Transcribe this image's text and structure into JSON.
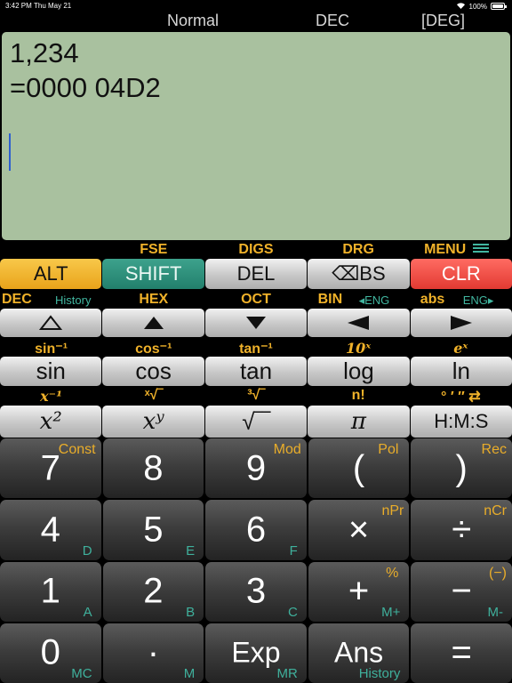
{
  "status_bar": {
    "time": "3:42 PM",
    "date": "Thu May 21",
    "battery": "100%"
  },
  "modes": {
    "notation": "Normal",
    "base": "DEC",
    "angle": "[DEG]"
  },
  "display": {
    "input": "1,234",
    "result": "=0000 04D2"
  },
  "top_labels": [
    "FSE",
    "DIGS",
    "DRG",
    "MENU"
  ],
  "row1": [
    "ALT",
    "SHIFT",
    "DEL",
    "⌫BS",
    "CLR"
  ],
  "row2_labels": {
    "dec": "DEC",
    "history": "History",
    "hex": "HEX",
    "oct": "OCT",
    "bin": "BIN",
    "eng_left": "◂ENG",
    "abs": "abs",
    "eng_right": "ENG▸"
  },
  "row2": [
    "△",
    "▲",
    "▼",
    "◀",
    "▶"
  ],
  "row3_labels": [
    "sin⁻¹",
    "cos⁻¹",
    "tan⁻¹",
    "10ˣ",
    "eˣ"
  ],
  "row3": [
    "sin",
    "cos",
    "tan",
    "log",
    "ln"
  ],
  "row4_labels": [
    "x⁻¹",
    "ˣ√‾",
    "³√‾",
    "n!",
    "° ′ ″ ⇄"
  ],
  "row4": [
    "x²",
    "xʸ",
    "√‾‾",
    "π",
    "H:M:S"
  ],
  "keys": [
    {
      "main": "7",
      "sup": "Const",
      "sub": ""
    },
    {
      "main": "8",
      "sup": "",
      "sub": ""
    },
    {
      "main": "9",
      "sup": "Mod",
      "sub": ""
    },
    {
      "main": "(",
      "sup": "Pol",
      "sub": ""
    },
    {
      "main": ")",
      "sup": "Rec",
      "sub": ""
    },
    {
      "main": "4",
      "sup": "",
      "sub": "D"
    },
    {
      "main": "5",
      "sup": "",
      "sub": "E"
    },
    {
      "main": "6",
      "sup": "",
      "sub": "F"
    },
    {
      "main": "×",
      "sup": "nPr",
      "sub": ""
    },
    {
      "main": "÷",
      "sup": "nCr",
      "sub": ""
    },
    {
      "main": "1",
      "sup": "",
      "sub": "A"
    },
    {
      "main": "2",
      "sup": "",
      "sub": "B"
    },
    {
      "main": "3",
      "sup": "",
      "sub": "C"
    },
    {
      "main": "+",
      "sup": "%",
      "sub": "M+"
    },
    {
      "main": "−",
      "sup": "(−)",
      "sub": "M-"
    },
    {
      "main": "0",
      "sup": "",
      "sub": "MC"
    },
    {
      "main": "·",
      "sup": "",
      "sub": "M"
    },
    {
      "main": "Exp",
      "sup": "",
      "sub": "MR"
    },
    {
      "main": "Ans",
      "sup": "",
      "sub": "History"
    },
    {
      "main": "=",
      "sup": "",
      "sub": ""
    }
  ]
}
